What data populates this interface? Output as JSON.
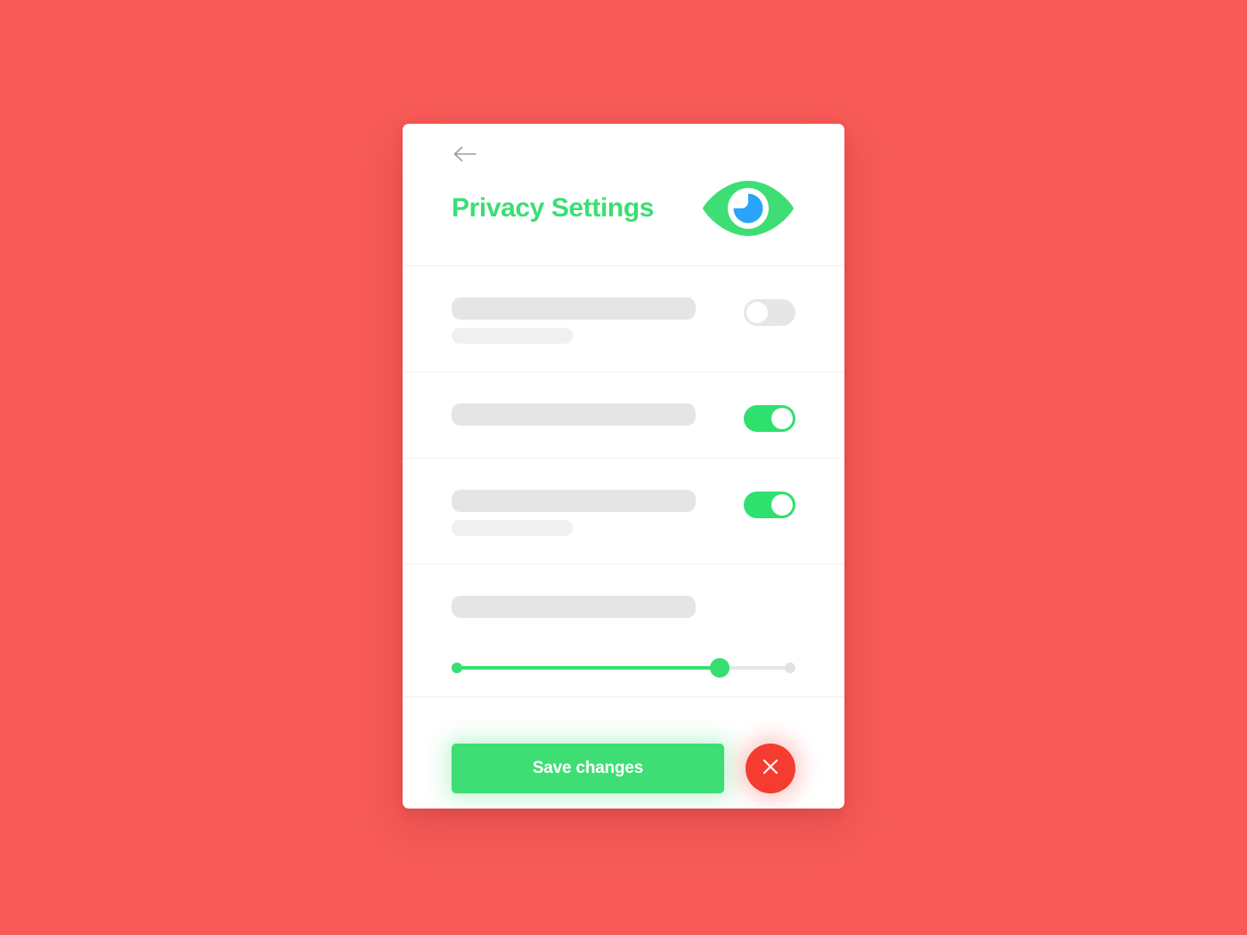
{
  "background_color": "#F75A57",
  "card": {
    "background_color": "#FFFFFF",
    "header": {
      "back_icon": "arrow-left-icon",
      "title": "Privacy Settings",
      "title_color": "#3BDE73",
      "brand_icon": "eye-icon",
      "brand_icon_colors": {
        "lens": "#3EDE74",
        "ring": "#FFFFFF",
        "iris": "#28A4FB"
      }
    },
    "settings_rows": [
      {
        "label_placeholder": "",
        "description_placeholder": "",
        "has_description": true,
        "control": "toggle",
        "toggle_state": "off",
        "toggle_off_color": "#E6E6E6"
      },
      {
        "label_placeholder": "",
        "description_placeholder": "",
        "has_description": false,
        "control": "toggle",
        "toggle_state": "on",
        "toggle_on_color": "#2FE06E"
      },
      {
        "label_placeholder": "",
        "description_placeholder": "",
        "has_description": true,
        "control": "toggle",
        "toggle_state": "on",
        "toggle_on_color": "#2FE06E"
      },
      {
        "label_placeholder": "",
        "has_description": false,
        "control": "slider",
        "slider": {
          "min": 0,
          "max": 100,
          "value": 77,
          "fill_color": "#37DE72",
          "track_color": "#E6E6E6"
        }
      }
    ],
    "actions": {
      "save_label": "Save changes",
      "save_color": "#3EDE74",
      "close_icon": "close-x-icon",
      "close_color": "#F43C31"
    }
  }
}
